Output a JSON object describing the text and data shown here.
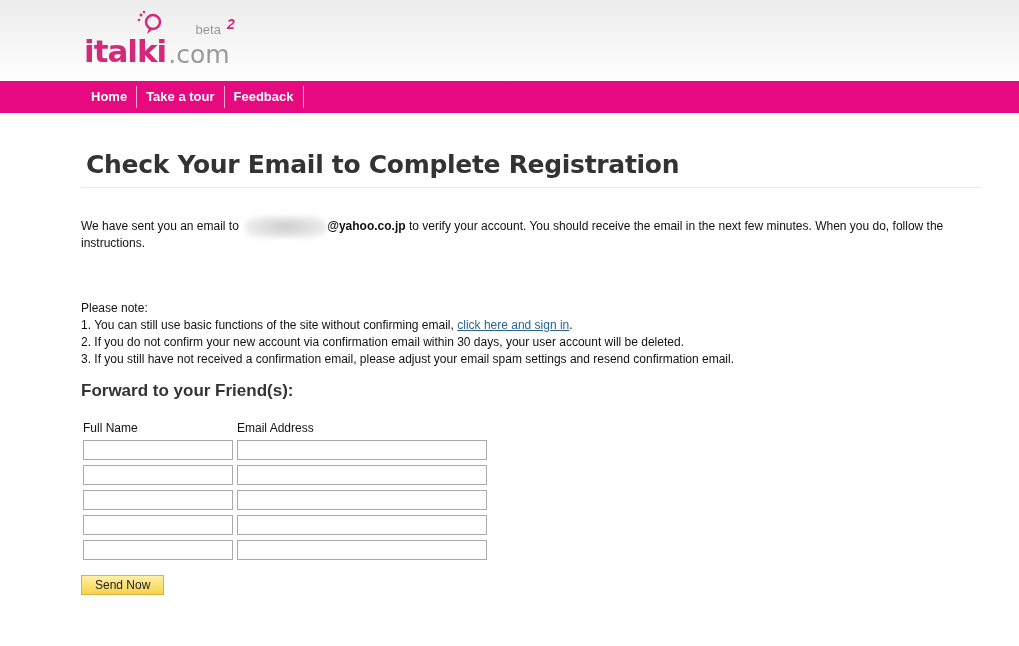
{
  "logo": {
    "name": "italki",
    "domain": ".com",
    "badge": "beta",
    "version": "2"
  },
  "nav": [
    {
      "label": "Home"
    },
    {
      "label": "Take a tour"
    },
    {
      "label": "Feedback"
    }
  ],
  "heading": "Check Your Email to Complete Registration",
  "message": {
    "before": "We have sent you an email to",
    "email": "@yahoo.co.jp",
    "after": "to verify your account. You should receive the email in the next few minutes. When you do, follow the instructions."
  },
  "note": {
    "title": "Please note:",
    "items": [
      {
        "text": "1. You can still use basic functions of the site without confirming email,",
        "link": "click here and sign in",
        "end": "."
      },
      {
        "text": "2. If you do not confirm your new account via confirmation email within 30 days, your user account will be deleted."
      },
      {
        "text": "3. If you still have not received a confirmation email, please adjust your email spam settings and resend confirmation email."
      }
    ]
  },
  "forward": {
    "title": "Forward to your Friend(s):",
    "columns": [
      "Full Name",
      "Email Address"
    ],
    "rows": [
      {
        "kind": "blank"
      },
      {
        "kind": "blank"
      },
      {
        "kind": "blank"
      },
      {
        "kind": "blank"
      },
      {
        "kind": "blank"
      }
    ],
    "button": "Send Now"
  }
}
